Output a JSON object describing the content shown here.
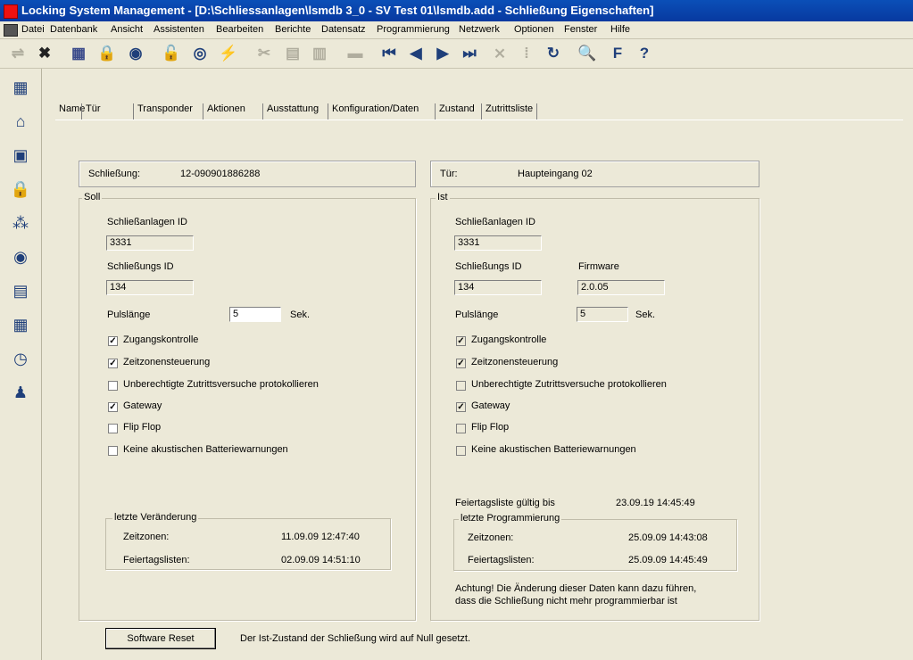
{
  "window": {
    "title": "Locking System Management - [D:\\Schliessanlagen\\lsmdb 3_0 - SV Test 01\\lsmdb.add - Schließung Eigenschaften]"
  },
  "menu": [
    "Datei",
    "Datenbank",
    "Ansicht",
    "Assistenten",
    "Bearbeiten",
    "Berichte",
    "Datensatz",
    "Programmierung",
    "Netzwerk",
    "Optionen",
    "Fenster",
    "Hilfe"
  ],
  "toolbar_icons": [
    "arrow-icon",
    "delete-x-icon",
    "add-record-icon",
    "add-lock-icon",
    "add-transponder-icon",
    "lock-query-icon",
    "transponder-query-icon",
    "lightning-icon",
    "cut-icon",
    "copy-icon",
    "paste-icon",
    "print-icon",
    "first-record-icon",
    "prev-record-icon",
    "next-record-icon",
    "last-record-icon",
    "delete-record-icon",
    "save-record-icon",
    "refresh-icon",
    "search-icon",
    "filter-icon",
    "help-icon"
  ],
  "tabs": [
    "Name",
    "Tür",
    "Transponder",
    "Aktionen",
    "Ausstattung",
    "Konfiguration/Daten",
    "Zustand",
    "Zutrittsliste"
  ],
  "header": {
    "lock_label": "Schließung:",
    "lock_value": "12-090901886288",
    "door_label": "Tür:",
    "door_value": "Haupteingang 02"
  },
  "soll": {
    "title": "Soll",
    "system_id_label": "Schließanlagen ID",
    "system_id": "3331",
    "lock_id_label": "Schließungs ID",
    "lock_id": "134",
    "pulse_label": "Pulslänge",
    "pulse": "5",
    "pulse_unit": "Sek.",
    "options": [
      {
        "label": "Zugangskontrolle",
        "checked": true
      },
      {
        "label": "Zeitzonensteuerung",
        "checked": true
      },
      {
        "label": "Unberechtigte Zutrittsversuche protokollieren",
        "checked": false
      },
      {
        "label": "Gateway",
        "checked": true
      },
      {
        "label": "Flip Flop",
        "checked": false
      },
      {
        "label": "Keine akustischen Batteriewarnungen",
        "checked": false
      }
    ],
    "changes_title": "letzte Veränderung",
    "timezones_label": "Zeitzonen:",
    "timezones_value": "11.09.09 12:47:40",
    "holidays_label": "Feiertagslisten:",
    "holidays_value": "02.09.09 14:51:10"
  },
  "ist": {
    "title": "Ist",
    "system_id_label": "Schließanlagen ID",
    "system_id": "3331",
    "lock_id_label": "Schließungs ID",
    "lock_id": "134",
    "firmware_label": "Firmware",
    "firmware": "2.0.05",
    "pulse_label": "Pulslänge",
    "pulse": "5",
    "pulse_unit": "Sek.",
    "options": [
      {
        "label": "Zugangskontrolle",
        "checked": true
      },
      {
        "label": "Zeitzonensteuerung",
        "checked": true
      },
      {
        "label": "Unberechtigte Zutrittsversuche protokollieren",
        "checked": false
      },
      {
        "label": "Gateway",
        "checked": true
      },
      {
        "label": "Flip Flop",
        "checked": false
      },
      {
        "label": "Keine akustischen Batteriewarnungen",
        "checked": false
      }
    ],
    "holiday_valid_label": "Feiertagsliste gültig bis",
    "holiday_valid_value": "23.09.19 14:45:49",
    "prog_title": "letzte Programmierung",
    "timezones_label": "Zeitzonen:",
    "timezones_value": "25.09.09 14:43:08",
    "holidays_label": "Feiertagslisten:",
    "holidays_value": "25.09.09 14:45:49",
    "warning_line1": "Achtung! Die Änderung dieser Daten kann dazu führen,",
    "warning_line2": "dass die Schließung nicht mehr programmierbar ist"
  },
  "footer": {
    "reset_button": "Software Reset",
    "reset_note": "Der Ist-Zustand der Schließung wird auf Null gesetzt."
  }
}
